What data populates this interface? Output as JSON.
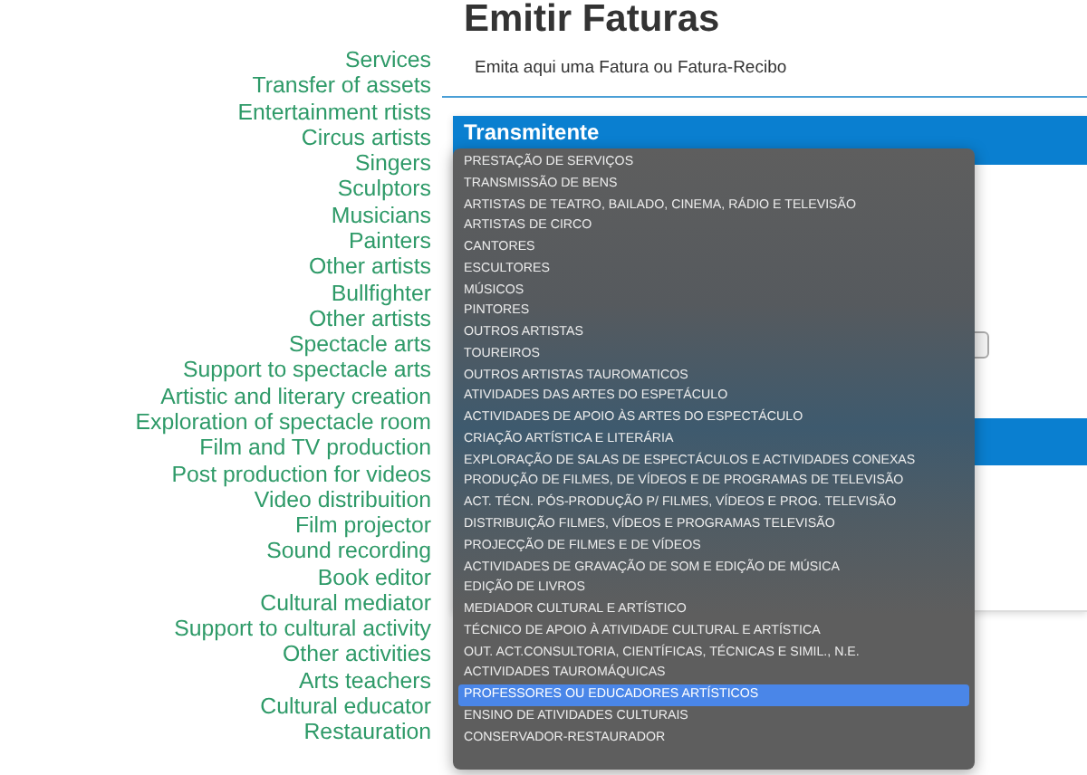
{
  "sidebar_labels": [
    "Services",
    "Transfer of assets",
    "Entertainment rtists",
    "Circus artists",
    "Singers",
    "Sculptors",
    "Musicians",
    "Painters",
    "Other artists",
    "Bullfighter",
    "Other artists",
    "Spectacle arts",
    "Support to spectacle arts",
    "Artistic and literary creation",
    "Exploration of spectacle room",
    "Film and TV production",
    "Post production for videos",
    "Video distribuition",
    "Film projector",
    "Sound recording",
    "Book editor",
    "Cultural mediator",
    "Support to cultural activity",
    "Other activities",
    "Arts teachers",
    "Cultural educator",
    "Restauration"
  ],
  "page": {
    "title": "Emitir Faturas",
    "subtitle": "Emita aqui uma Fatura ou Fatura-Recibo"
  },
  "card": {
    "title": "Transmitente"
  },
  "dropdown": {
    "options": [
      {
        "label": "PRESTAÇÃO DE SERVIÇOS",
        "selected": false
      },
      {
        "label": "TRANSMISSÃO DE BENS",
        "selected": false
      },
      {
        "label": "ARTISTAS DE TEATRO, BAILADO, CINEMA, RÁDIO E TELEVISÃO",
        "selected": false
      },
      {
        "label": "ARTISTAS DE CIRCO",
        "selected": false
      },
      {
        "label": "CANTORES",
        "selected": false
      },
      {
        "label": "ESCULTORES",
        "selected": false
      },
      {
        "label": "MÚSICOS",
        "selected": false
      },
      {
        "label": "PINTORES",
        "selected": false
      },
      {
        "label": "OUTROS ARTISTAS",
        "selected": false
      },
      {
        "label": "TOUREIROS",
        "selected": false
      },
      {
        "label": "OUTROS ARTISTAS TAUROMATICOS",
        "selected": false
      },
      {
        "label": "ATIVIDADES DAS ARTES DO ESPETÁCULO",
        "selected": false
      },
      {
        "label": "ACTIVIDADES DE APOIO ÀS ARTES DO ESPECTÁCULO",
        "selected": false
      },
      {
        "label": "CRIAÇÃO ARTÍSTICA E LITERÁRIA",
        "selected": false
      },
      {
        "label": "EXPLORAÇÃO DE SALAS DE ESPECTÁCULOS E ACTIVIDADES CONEXAS",
        "selected": false
      },
      {
        "label": "PRODUÇÃO DE FILMES, DE VÍDEOS E DE PROGRAMAS DE TELEVISÃO",
        "selected": false
      },
      {
        "label": "ACT. TÉCN. PÓS-PRODUÇÃO P/ FILMES, VÍDEOS E PROG. TELEVISÃO",
        "selected": false
      },
      {
        "label": "DISTRIBUIÇÃO FILMES, VÍDEOS E PROGRAMAS TELEVISÃO",
        "selected": false
      },
      {
        "label": "PROJECÇÃO DE FILMES E DE VÍDEOS",
        "selected": false
      },
      {
        "label": "ACTIVIDADES DE GRAVAÇÃO DE SOM E EDIÇÃO DE MÚSICA",
        "selected": false
      },
      {
        "label": "EDIÇÃO DE LIVROS",
        "selected": false
      },
      {
        "label": "MEDIADOR CULTURAL E ARTÍSTICO",
        "selected": false
      },
      {
        "label": "TÉCNICO DE APOIO À ATIVIDADE CULTURAL E ARTÍSTICA",
        "selected": false
      },
      {
        "label": "OUT. ACT.CONSULTORIA, CIENTÍFICAS, TÉCNICAS E SIMIL., N.E.",
        "selected": false
      },
      {
        "label": "ACTIVIDADES TAUROMÁQUICAS",
        "selected": false
      },
      {
        "label": "PROFESSORES OU EDUCADORES ARTÍSTICOS",
        "selected": true
      },
      {
        "label": "ENSINO DE ATIVIDADES CULTURAIS",
        "selected": false
      },
      {
        "label": "CONSERVADOR-RESTAURADOR",
        "selected": false
      }
    ]
  }
}
